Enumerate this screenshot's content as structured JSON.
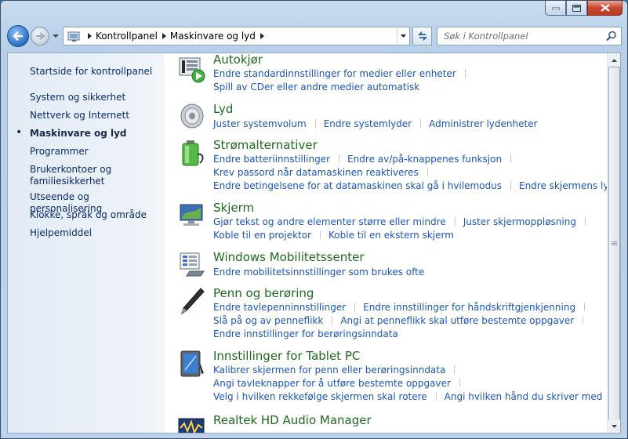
{
  "address": {
    "crumbs": [
      "Kontrollpanel",
      "Maskinvare og lyd"
    ]
  },
  "search": {
    "placeholder": "Søk i Kontrollpanel"
  },
  "sidebar": {
    "home": "Startside for kontrollpanel",
    "items": [
      "System og sikkerhet",
      "Nettverk og Internett",
      "Maskinvare og lyd",
      "Programmer",
      "Brukerkontoer og familiesikkerhet",
      "Utseende og personalisering",
      "Klokke, språk og område",
      "Hjelpemiddel"
    ],
    "active_index": 2
  },
  "categories": [
    {
      "title": "Autokjør",
      "icon": "autoplay-icon",
      "rows": [
        [
          "Endre standardinnstillinger for medier eller enheter"
        ],
        [
          "Spill av CDer eller andre medier automatisk"
        ]
      ]
    },
    {
      "title": "Lyd",
      "icon": "speaker-icon",
      "rows": [
        [
          "Juster systemvolum",
          "Endre systemlyder",
          "Administrer lydenheter"
        ]
      ]
    },
    {
      "title": "Strømalternativer",
      "icon": "battery-icon",
      "rows": [
        [
          "Endre batteriinnstillinger",
          "Endre av/på-knappenes funksjon"
        ],
        [
          "Krev passord når datamaskinen reaktiveres"
        ],
        [
          "Endre betingelsene for at datamaskinen skal gå i hvilemodus",
          "Endre skjermens lysstyrke"
        ]
      ]
    },
    {
      "title": "Skjerm",
      "icon": "display-icon",
      "rows": [
        [
          "Gjør tekst og andre elementer større eller mindre",
          "Juster skjermoppløsning"
        ],
        [
          "Koble til en projektor",
          "Koble til en ekstern skjerm"
        ]
      ]
    },
    {
      "title": "Windows Mobilitetssenter",
      "icon": "mobility-center-icon",
      "rows": [
        [
          "Endre mobilitetsinnstillinger som brukes ofte"
        ]
      ]
    },
    {
      "title": "Penn og berøring",
      "icon": "pen-icon",
      "rows": [
        [
          "Endre tavlepenninnstillinger",
          "Endre innstillinger for håndskriftgjenkjenning"
        ],
        [
          "Slå på og av penneflikk",
          "Angi at penneflikk skal utføre bestemte oppgaver"
        ],
        [
          "Endre innstillinger for berøringsinndata"
        ]
      ]
    },
    {
      "title": "Innstillinger for Tablet PC",
      "icon": "tablet-pc-icon",
      "rows": [
        [
          "Kalibrer skjermen for penn eller berøringsinndata"
        ],
        [
          "Angi tavleknapper for å utføre bestemte oppgaver"
        ],
        [
          "Velg i hvilken rekkefølge skjermen skal rotere",
          "Angi hvilken hånd du skriver med"
        ]
      ]
    },
    {
      "title": "Realtek HD Audio Manager",
      "icon": "realtek-audio-icon",
      "rows": []
    }
  ]
}
